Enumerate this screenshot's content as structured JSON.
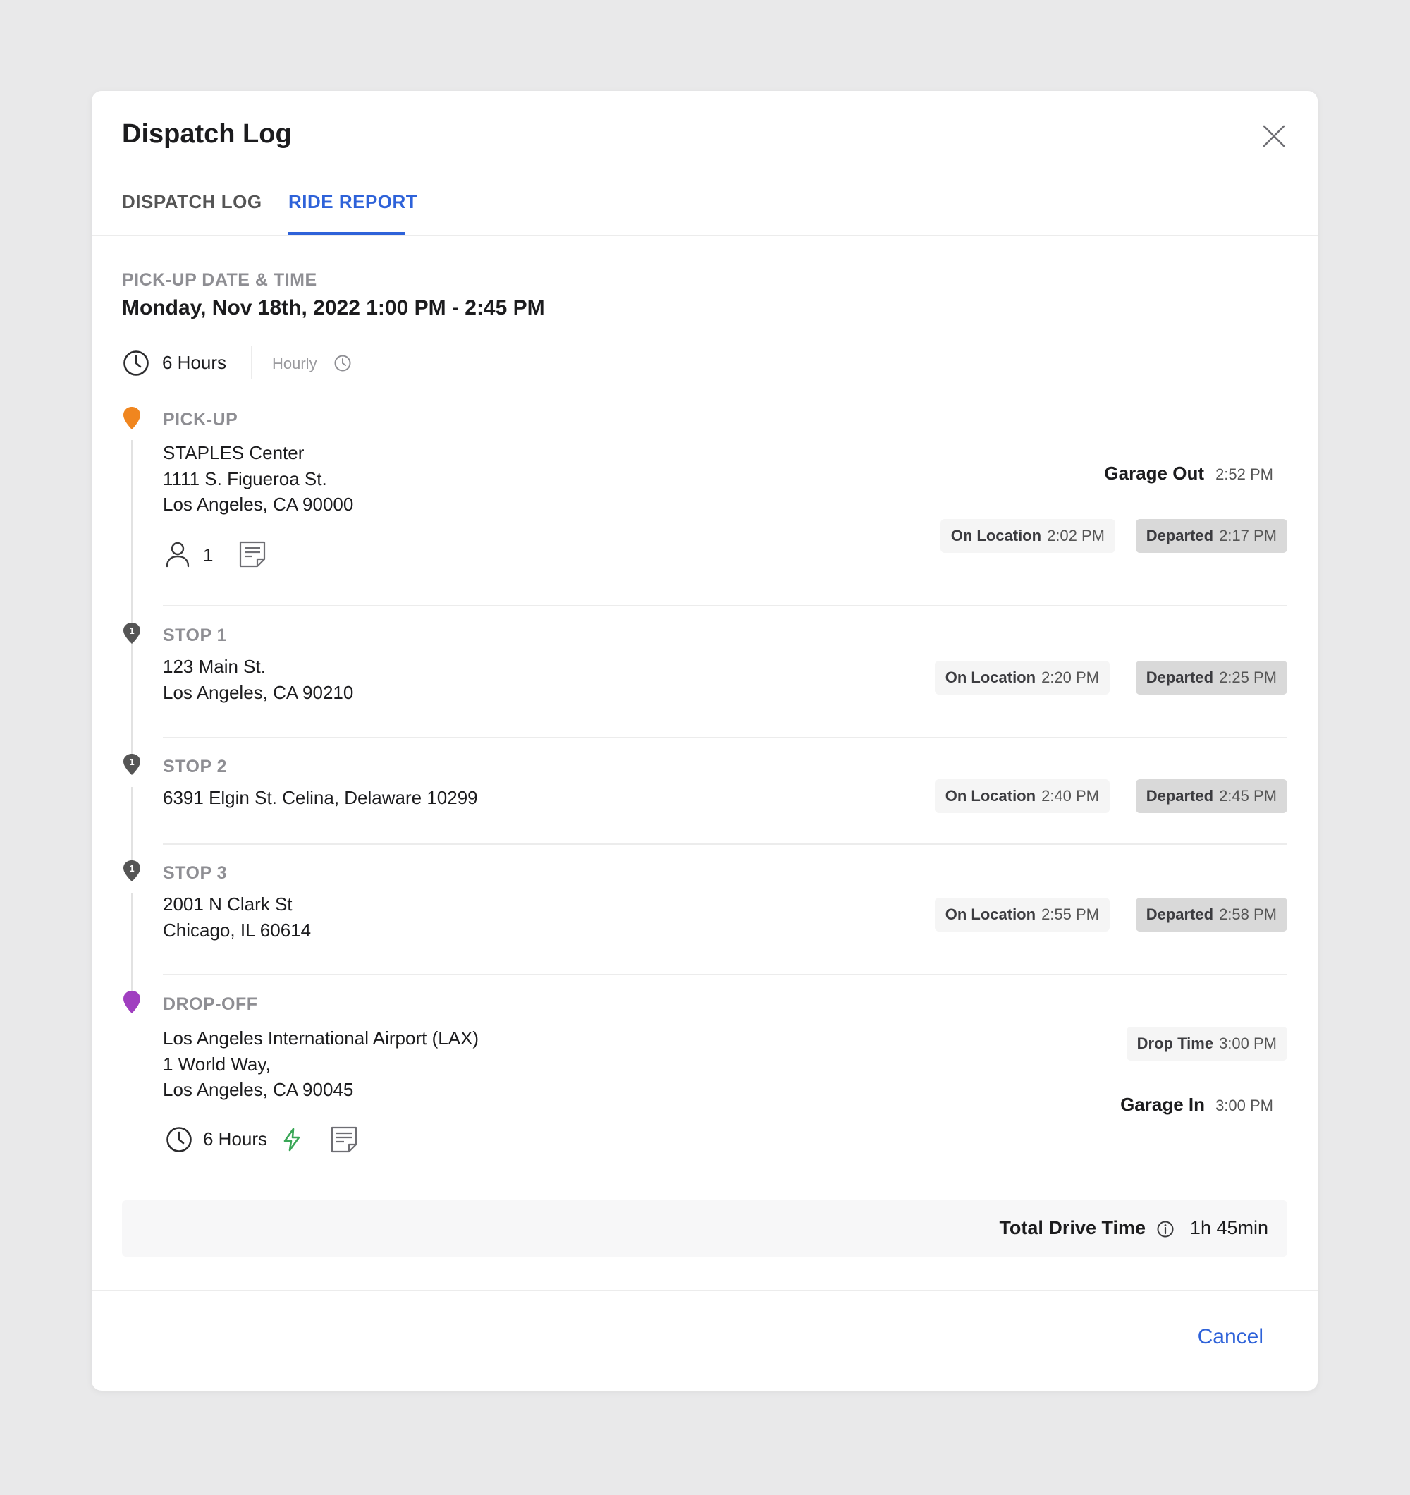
{
  "modal": {
    "title": "Dispatch Log"
  },
  "tabs": [
    {
      "label": "DISPATCH LOG",
      "active": false
    },
    {
      "label": "RIDE REPORT",
      "active": true
    }
  ],
  "pickup_header": {
    "label": "PICK-UP DATE & TIME",
    "datetime": "Monday, Nov 18th, 2022 1:00 PM - 2:45 PM",
    "duration": "6 Hours",
    "type": "Hourly"
  },
  "pickup": {
    "label": "PICK-UP",
    "pin_color": "#f0861f",
    "address": [
      "STAPLES Center",
      "1111 S. Figueroa St.",
      "Los Angeles, CA 90000"
    ],
    "passengers": "1",
    "garage_out_label": "Garage Out",
    "garage_out_time": "2:52 PM",
    "on_location_label": "On Location",
    "on_location_time": "2:02 PM",
    "departed_label": "Departed",
    "departed_time": "2:17 PM"
  },
  "stops": [
    {
      "label": "STOP 1",
      "address": [
        "123 Main St.",
        "Los Angeles, CA 90210"
      ],
      "on_location_label": "On Location",
      "on_location_time": "2:20 PM",
      "departed_label": "Departed",
      "departed_time": "2:25 PM"
    },
    {
      "label": "STOP 2",
      "address": [
        "6391 Elgin St. Celina, Delaware 10299"
      ],
      "on_location_label": "On Location",
      "on_location_time": "2:40 PM",
      "departed_label": "Departed",
      "departed_time": "2:45 PM"
    },
    {
      "label": "STOP 3",
      "address": [
        "2001 N Clark St",
        "Chicago, IL 60614"
      ],
      "on_location_label": "On Location",
      "on_location_time": "2:55 PM",
      "departed_label": "Departed",
      "departed_time": "2:58 PM"
    }
  ],
  "dropoff": {
    "label": "DROP-OFF",
    "pin_color": "#a03fc0",
    "address": [
      "Los Angeles International Airport (LAX)",
      "1 World Way,",
      "Los Angeles, CA 90045"
    ],
    "duration": "6 Hours",
    "drop_time_label": "Drop Time",
    "drop_time": "3:00 PM",
    "garage_in_label": "Garage In",
    "garage_in_time": "3:00 PM"
  },
  "total": {
    "label": "Total Drive Time",
    "value": "1h 45min"
  },
  "footer": {
    "cancel_label": "Cancel"
  },
  "colors": {
    "accent": "#2e62d9",
    "stop_pin": "#555555",
    "bolt": "#3aa757"
  },
  "icons": [
    "close-icon",
    "clock-icon",
    "pin-icon",
    "person-icon",
    "note-icon",
    "bolt-icon",
    "info-icon"
  ]
}
